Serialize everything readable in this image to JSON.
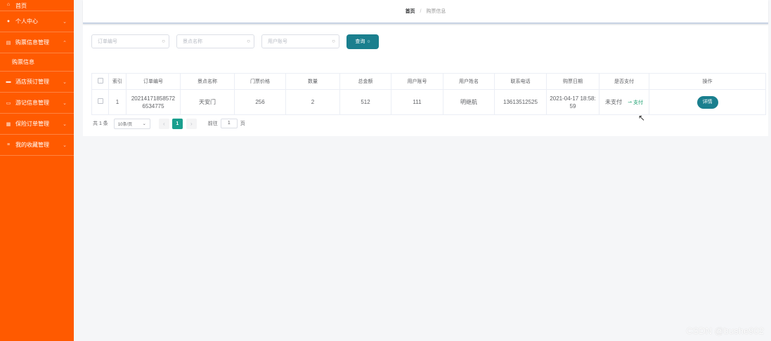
{
  "sidebar": {
    "items": [
      {
        "label": "首页",
        "icon": "home-icon"
      },
      {
        "label": "个人中心",
        "icon": "user-icon"
      },
      {
        "label": "购票信息管理",
        "icon": "ticket-icon"
      },
      {
        "label": "酒店预订管理",
        "icon": "hotel-icon"
      },
      {
        "label": "游记信息管理",
        "icon": "notes-icon"
      },
      {
        "label": "保险订单管理",
        "icon": "insurance-icon"
      },
      {
        "label": "我的收藏管理",
        "icon": "favorite-icon"
      }
    ],
    "submenu": {
      "label": "购票信息"
    },
    "color": "#ff5a00"
  },
  "breadcrumb": {
    "home": "首页",
    "separator": "/",
    "current": "购票信息"
  },
  "search": {
    "order_placeholder": "订单编号",
    "scenic_placeholder": "景点名称",
    "account_placeholder": "用户账号",
    "button_label": "查询",
    "button_color": "#1a7f8e"
  },
  "table": {
    "headers": [
      "索引",
      "订单编号",
      "景点名称",
      "门票价格",
      "数量",
      "总金额",
      "用户账号",
      "用户姓名",
      "联系电话",
      "购票日期",
      "是否支付",
      "操作"
    ],
    "rows": [
      {
        "index": "1",
        "order_no": "202141718585726534775",
        "scenic": "天安门",
        "price": "256",
        "quantity": "2",
        "total": "512",
        "account": "111",
        "name": "明继航",
        "phone": "13613512525",
        "date": "2021-04-17 18:58:59",
        "paid": "未支付",
        "pay_action": "支付",
        "detail": "详情"
      }
    ]
  },
  "pager": {
    "total": "共 1 条",
    "page_size": "10条/页",
    "current_page": "1",
    "goto_label": "前往",
    "goto_value": "1",
    "page_unit": "页"
  },
  "watermark": "CSDN @bushe902"
}
